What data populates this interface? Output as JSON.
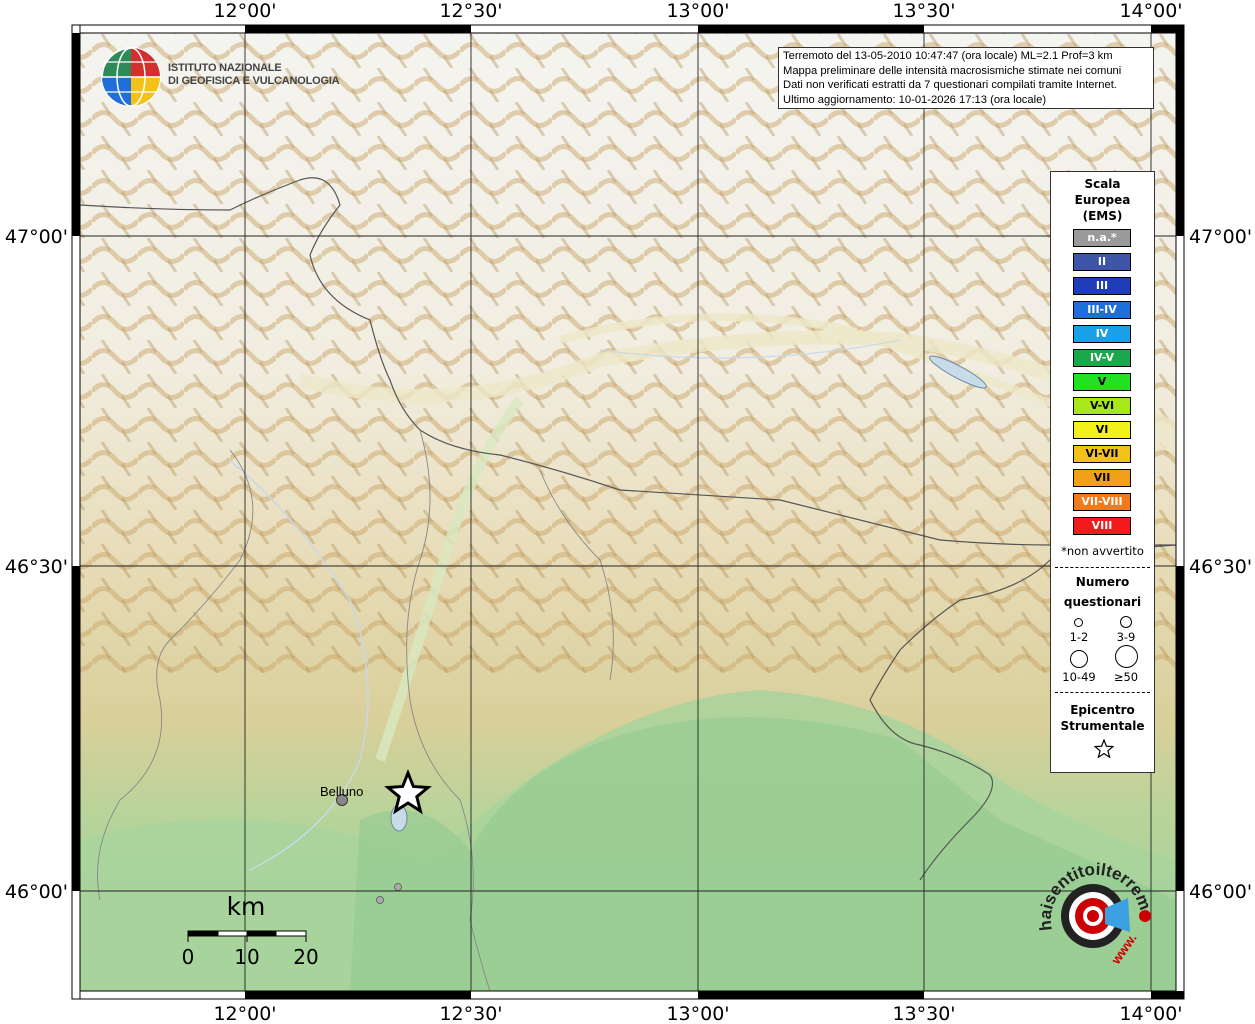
{
  "info": {
    "line1": "Terremoto del 13-05-2010 10:47:47 (ora locale) ML=2.1 Prof=3 km",
    "line2": "Mappa preliminare delle intensità macrosismiche stimate nei comuni",
    "line3": "Dati non verificati estratti da 7 questionari compilati tramite Internet.",
    "line4": "Ultimo aggiornamento: 10-01-2026 17:13 (ora locale)"
  },
  "axes": {
    "lon_labels": [
      "12°00'",
      "12°30'",
      "13°00'",
      "13°30'",
      "14°00'"
    ],
    "lat_labels": [
      "47°00'",
      "46°30'",
      "46°00'"
    ]
  },
  "institute": {
    "line1": "ISTITUTO NAZIONALE",
    "line2": "DI GEOFISICA E VULCANOLOGIA"
  },
  "legend": {
    "title1": "Scala",
    "title2": "Europea",
    "title3": "(EMS)",
    "ems": [
      {
        "label": "n.a.*",
        "color": "#9a9a9a"
      },
      {
        "label": "II",
        "color": "#3f55a8"
      },
      {
        "label": "III",
        "color": "#1f3db8"
      },
      {
        "label": "III-IV",
        "color": "#1f6fd8"
      },
      {
        "label": "IV",
        "color": "#1aa0e8"
      },
      {
        "label": "IV-V",
        "color": "#1aa84a"
      },
      {
        "label": "V",
        "color": "#22e022"
      },
      {
        "label": "V-VI",
        "color": "#a6e81a"
      },
      {
        "label": "VI",
        "color": "#f2f21a"
      },
      {
        "label": "VI-VII",
        "color": "#f2c21a"
      },
      {
        "label": "VII",
        "color": "#f2a01a"
      },
      {
        "label": "VII-VIII",
        "color": "#f27a1a"
      },
      {
        "label": "VIII",
        "color": "#f21a1a"
      }
    ],
    "na_note": "*non avvertito",
    "num_title1": "Numero",
    "num_title2": "questionari",
    "size_labels": [
      "1-2",
      "3-9",
      "10-49",
      "≥50"
    ],
    "epi_title1": "Epicentro",
    "epi_title2": "Strumentale"
  },
  "places": {
    "city": "Belluno"
  },
  "scale_bar": {
    "unit": "km",
    "ticks": [
      "0",
      "10",
      "20"
    ]
  },
  "logo": {
    "text": "haisentitoilterremoto.it",
    "www": "www."
  }
}
